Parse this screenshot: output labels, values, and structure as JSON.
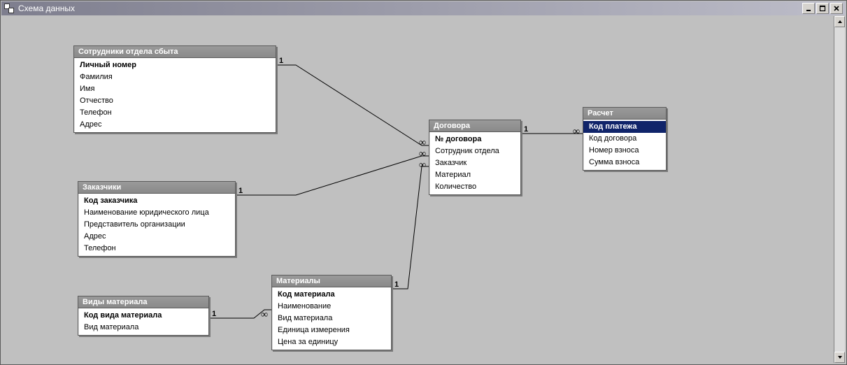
{
  "window": {
    "title": "Схема данных"
  },
  "entities": {
    "staff": {
      "title": "Сотрудники отдела сбыта",
      "fields": [
        "Личный номер",
        "Фамилия",
        "Имя",
        "Отчество",
        "Телефон",
        "Адрес"
      ]
    },
    "customers": {
      "title": "Заказчики",
      "fields": [
        "Код заказчика",
        "Наименование юридического лица",
        "Представитель организации",
        "Адрес",
        "Телефон"
      ]
    },
    "mat_types": {
      "title": "Виды материала",
      "fields": [
        "Код вида материала",
        "Вид материала"
      ]
    },
    "materials": {
      "title": "Материалы",
      "fields": [
        "Код материала",
        "Наименование",
        "Вид материала",
        "Единица измерения",
        "Цена за единицу"
      ]
    },
    "contracts": {
      "title": "Договора",
      "fields": [
        "№ договора",
        "Сотрудник отдела",
        "Заказчик",
        "Материал",
        "Количество"
      ]
    },
    "payment": {
      "title": "Расчет",
      "fields": [
        "Код платежа",
        "Код договора",
        "Номер взноса",
        "Сумма взноса"
      ]
    }
  },
  "relations": {
    "one": "1",
    "many": "∞"
  }
}
